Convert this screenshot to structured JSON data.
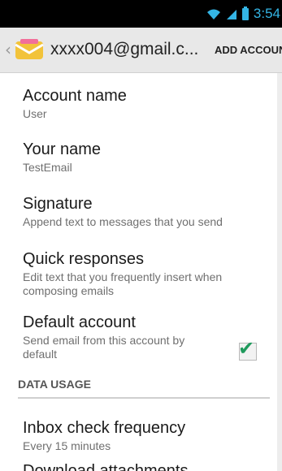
{
  "status_bar": {
    "time": "3:54"
  },
  "action_bar": {
    "account": "xxxx004@gmail.c...",
    "add_account": "ADD ACCOUNT",
    "icon": "email-envelope-icon"
  },
  "preferences": [
    {
      "title": "Account name",
      "summary": "User"
    },
    {
      "title": "Your name",
      "summary": "TestEmail"
    },
    {
      "title": "Signature",
      "summary": "Append text to messages that you send"
    },
    {
      "title": "Quick responses",
      "summary": "Edit text that you frequently insert when composing emails"
    },
    {
      "title": "Default account",
      "summary": "Send email from this account by default",
      "checked": true
    }
  ],
  "sections": {
    "data_usage": "DATA USAGE"
  },
  "data_usage": [
    {
      "title": "Inbox check frequency",
      "summary": "Every 15 minutes"
    },
    {
      "title": "Download attachments",
      "summary": ""
    }
  ],
  "colors": {
    "status_accent": "#34b5e5",
    "check_green": "#1f9a5c"
  }
}
